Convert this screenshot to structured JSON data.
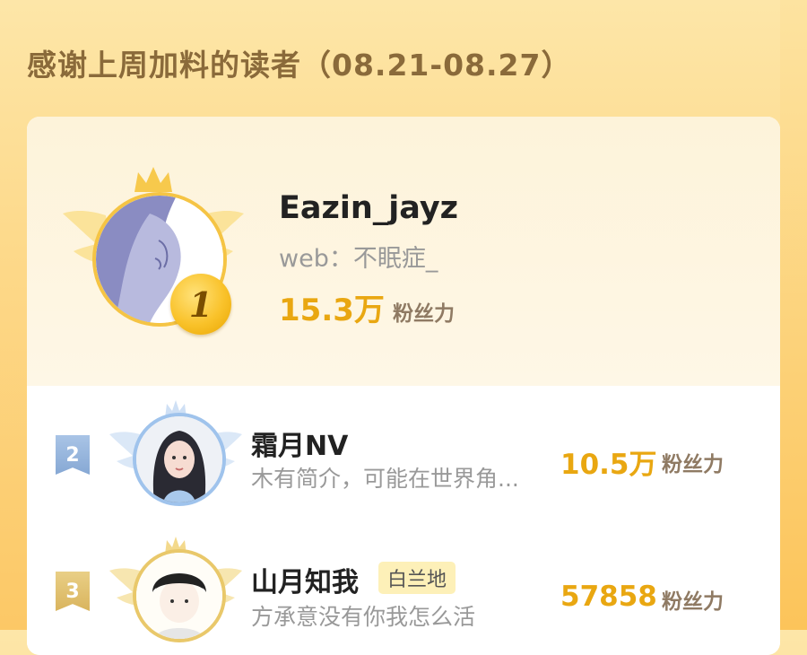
{
  "page": {
    "title": "感谢上周加料的读者（08.21-08.27）"
  },
  "colors": {
    "value": "#e9a711",
    "unit": "#8f7a63",
    "gold": "#f5c444",
    "silver_blue": "#9fc3ec",
    "bronze": "#e9c86a"
  },
  "readers": [
    {
      "rank": "1",
      "name": "Eazin_jayz",
      "intro": "web：不眠症_",
      "value": "15.3万",
      "unit": "粉丝力",
      "avatar_icon": "illustrated-man-avatar"
    },
    {
      "rank": "2",
      "name": "霜月NV",
      "intro": "木有简介，可能在世界角...",
      "value": "10.5万",
      "unit": "粉丝力",
      "avatar_icon": "girl-avatar"
    },
    {
      "rank": "3",
      "name": "山月知我",
      "tag": "白兰地",
      "intro": "方承意没有你我怎么活",
      "value": "57858",
      "unit": "粉丝力",
      "avatar_icon": "comic-boy-avatar"
    }
  ]
}
